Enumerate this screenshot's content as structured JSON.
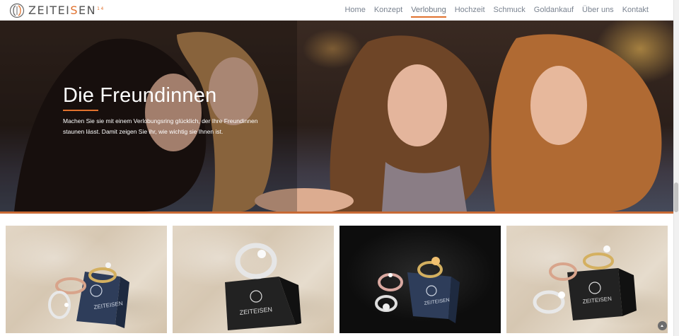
{
  "logo": {
    "text_a": "ZEITEI",
    "text_b": "S",
    "text_c": "EN",
    "sup": "14"
  },
  "nav": {
    "items": [
      "Home",
      "Konzept",
      "Verlobung",
      "Hochzeit",
      "Schmuck",
      "Goldankauf",
      "Über uns",
      "Kontakt"
    ],
    "active": "Verlobung"
  },
  "hero": {
    "title": "Die Freundinnen",
    "text": "Machen Sie sie mit einem Verlobungsring glücklich, der Ihre Freundinnen staunen lässt. Damit zeigen Sie ihr, wie wichtig sie Ihnen ist."
  },
  "gallery": {
    "box_label": "ZEITEISEN"
  },
  "colors": {
    "accent": "#e0712d",
    "nav_text": "#7a8390"
  }
}
